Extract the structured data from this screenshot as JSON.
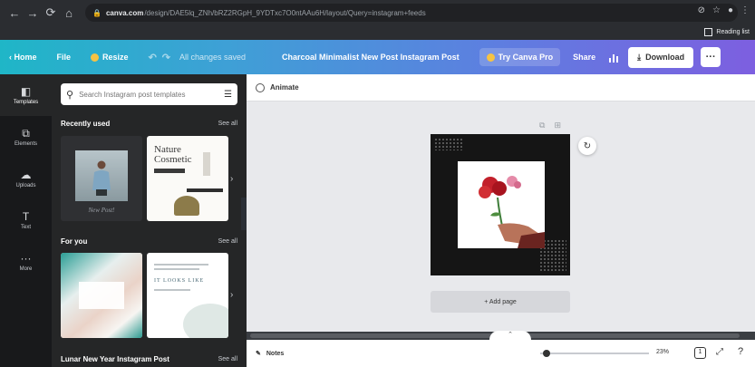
{
  "browser": {
    "url_host": "canva.com",
    "url_path": "/design/DAE5lq_ZNh/bRZ2RGpH_9YDTxc7O0ntAAu6H/layout/Query=instagram+feeds",
    "reading_list": "Reading list"
  },
  "toolbar": {
    "home": "Home",
    "file": "File",
    "resize": "Resize",
    "saved_status": "All changes saved",
    "doc_title": "Charcoal Minimalist New Post Instagram Post",
    "try_pro": "Try Canva Pro",
    "share": "Share",
    "download": "Download",
    "more": "···"
  },
  "rail": {
    "items": [
      {
        "label": "Templates",
        "icon": "templates-icon"
      },
      {
        "label": "Elements",
        "icon": "elements-icon"
      },
      {
        "label": "Uploads",
        "icon": "upload-icon"
      },
      {
        "label": "Text",
        "icon": "text-icon"
      },
      {
        "label": "More",
        "icon": "more-icon"
      }
    ]
  },
  "panel": {
    "search_placeholder": "Search Instagram post templates",
    "recent_title": "Recently used",
    "see_all": "See all",
    "thumb1_caption": "New Post!",
    "thumb2_title_line1": "Nature",
    "thumb2_title_line2": "Cosmetic",
    "for_you_title": "For you",
    "thumb4_text": "IT LOOKS LIKE",
    "bottom_title": "Lunar New Year Instagram Post"
  },
  "canvas": {
    "animate": "Animate",
    "add_page": "+ Add page"
  },
  "bottom": {
    "notes": "Notes",
    "zoom": "23%",
    "zoom_value_percent": 23,
    "page_count": "1"
  },
  "colors": {
    "toolbar_start": "#1fb6c7",
    "toolbar_end": "#7d5fe0",
    "crown": "#f6c344"
  }
}
